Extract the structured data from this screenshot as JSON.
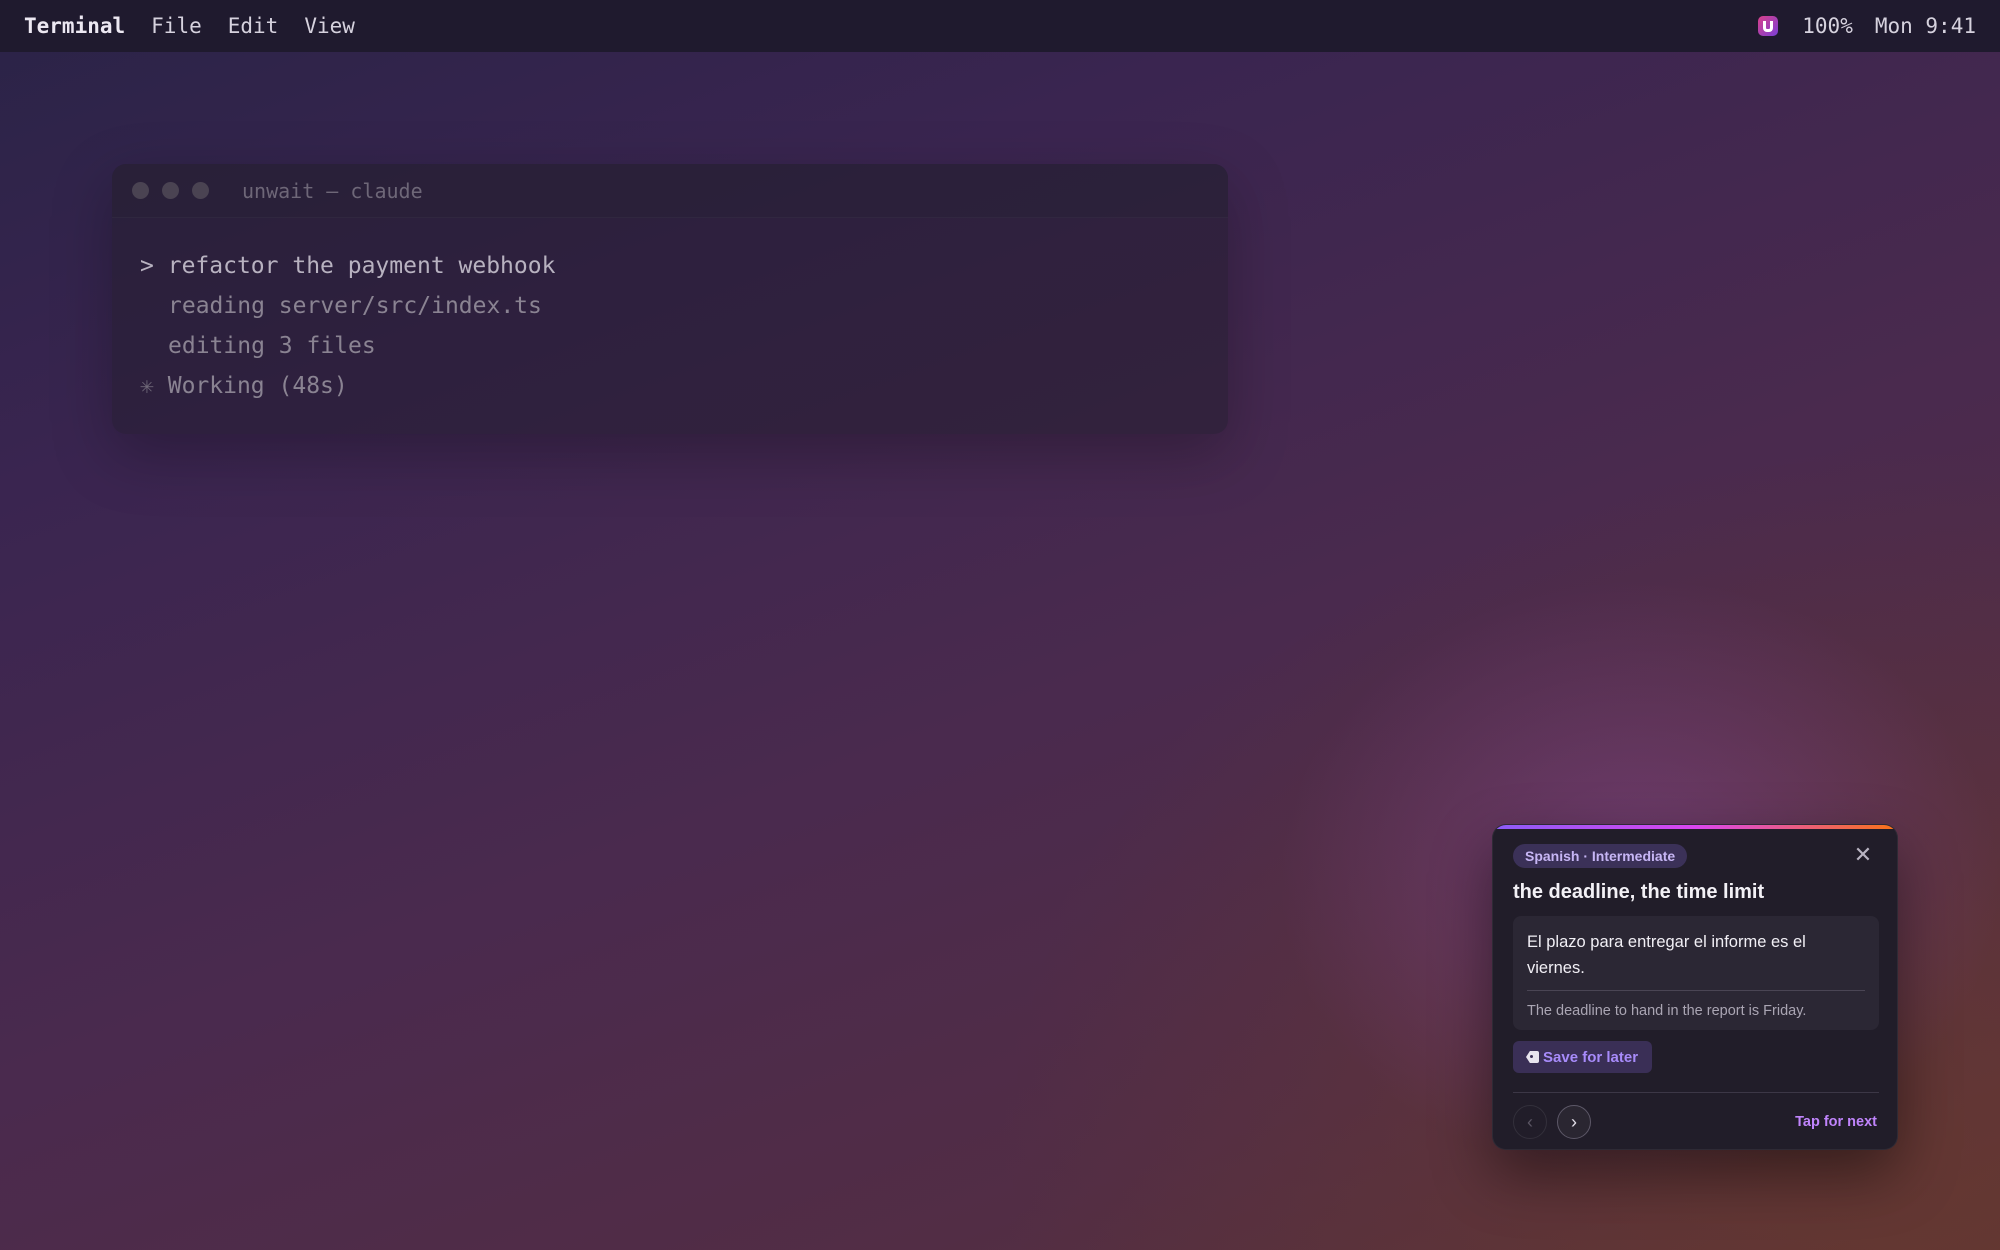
{
  "menubar": {
    "app_name": "Terminal",
    "menus": [
      "File",
      "Edit",
      "View"
    ],
    "tray_icon": "unwait-logo-icon",
    "battery": "100%",
    "clock": "Mon 9:41"
  },
  "terminal": {
    "title": "unwait — claude",
    "prompt_symbol": ">",
    "command": "refactor the payment webhook",
    "output": [
      "reading server/src/index.ts",
      "editing 3 files"
    ],
    "spinner_glyph": "✳",
    "status": "Working (48s)"
  },
  "card": {
    "tag": "Spanish · Intermediate",
    "headword": "the deadline, the time limit",
    "example": "El plazo para entregar el informe es el viernes.",
    "translation": "The deadline to hand in the report is Friday.",
    "save_label": "Save for later",
    "prev_symbol": "‹",
    "next_symbol": "›",
    "tap_next": "Tap for next",
    "close_symbol": "✕",
    "colors": {
      "accent_start": "#8b5cf6",
      "accent_mid": "#d946ef",
      "accent_end": "#f97316",
      "link": "#c084fc"
    }
  }
}
